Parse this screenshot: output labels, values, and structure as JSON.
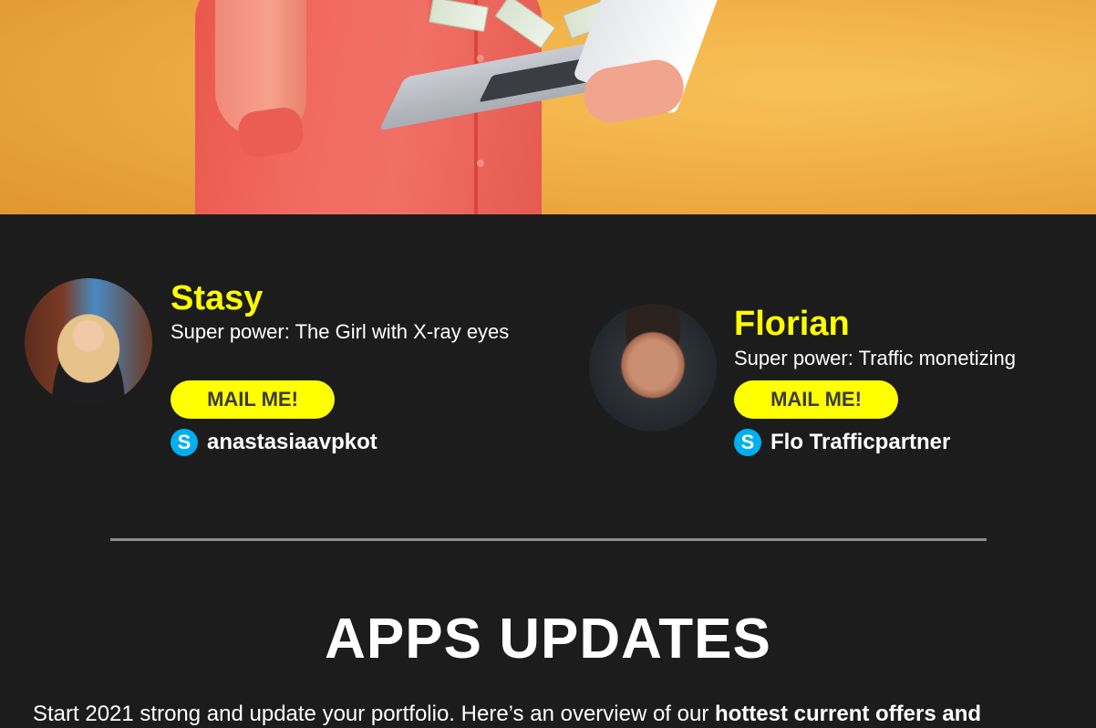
{
  "contacts": [
    {
      "name": "Stasy",
      "power": "Super power: The Girl with X-ray eyes",
      "button_label": "MAIL ME!",
      "skype_handle": "anastasiaavpkot"
    },
    {
      "name": "Florian",
      "power": "Super power: Traffic monetizing",
      "button_label": "MAIL ME!",
      "skype_handle": "Flo Trafficpartner"
    }
  ],
  "skype_icon_glyph": "S",
  "section": {
    "title": "APPS UPDATES",
    "intro_plain": "Start 2021 strong and update your portfolio. Here’s an overview of our ",
    "intro_bold": "hottest current offers and"
  },
  "colors": {
    "background": "#1c1c1c",
    "name_yellow": "#ffff00",
    "button_yellow": "#ffff00",
    "skype_blue": "#00aff0",
    "divider": "#8d8d8d"
  }
}
